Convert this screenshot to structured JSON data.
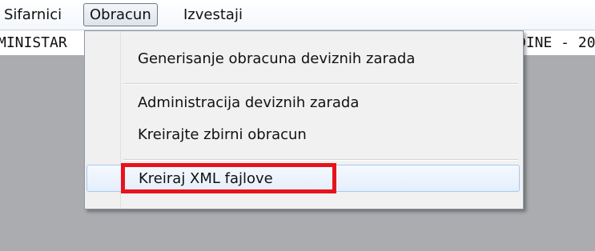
{
  "menubar": {
    "items": [
      {
        "label": "Sifarnici"
      },
      {
        "label": "Obracun"
      },
      {
        "label": "Izvestaji"
      }
    ]
  },
  "title_strip": {
    "left_text": "MINISTAR",
    "right_text": "DINE - 20"
  },
  "dropdown": {
    "items": [
      {
        "label": "Generisanje obracuna deviznih zarada"
      },
      {
        "label": "Administracija deviznih zarada"
      },
      {
        "label": "Kreirajte zbirni obracun"
      },
      {
        "label": "Kreiraj XML fajlove"
      }
    ]
  },
  "colors": {
    "highlight_box": "#e8121c",
    "workspace": "#abacaf",
    "hover_border": "#a8c8f0"
  }
}
